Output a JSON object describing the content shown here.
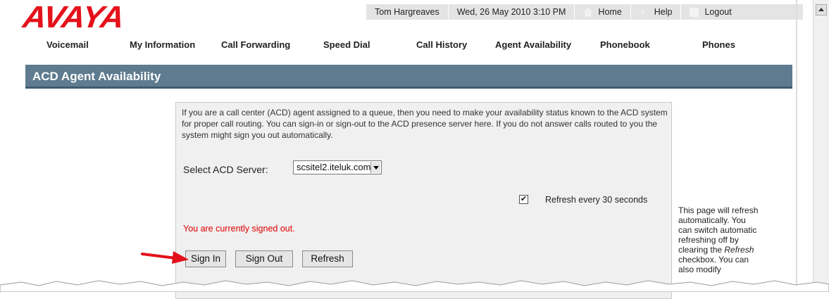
{
  "header": {
    "logo": "AVAYA",
    "user": "Tom Hargreaves",
    "datetime": "Wed, 26 May 2010 3:10 PM",
    "home": "Home",
    "help": "Help",
    "logout": "Logout"
  },
  "nav": [
    {
      "label": "Voicemail"
    },
    {
      "label": "My Information"
    },
    {
      "label": "Call Forwarding"
    },
    {
      "label": "Speed Dial"
    },
    {
      "label": "Call History"
    },
    {
      "label": "Agent Availability"
    },
    {
      "label": "Phonebook"
    },
    {
      "label": "Phones"
    }
  ],
  "page_title": "ACD Agent Availability",
  "panel": {
    "intro": "If you are a call center (ACD) agent assigned to a queue, then you need to make your availability status known to the ACD system for proper call routing. You can sign-in or sign-out to the ACD presence server here. If you do not answer calls routed to you the system might sign you out automatically.",
    "select_label": "Select ACD Server:",
    "server_value": "scsitel2.iteluk.com",
    "refresh_checked": true,
    "refresh_prefix": "Refresh every",
    "refresh_interval": "30",
    "refresh_suffix": "seconds",
    "status": "You are currently signed out.",
    "buttons": {
      "sign_in": "Sign In",
      "sign_out": "Sign Out",
      "refresh": "Refresh"
    }
  },
  "side_note": {
    "line1": "This page will refresh automatically. You can switch automatic refreshing off by clearing the",
    "italic": "Refresh",
    "line2": "checkbox. You can also modify"
  },
  "colors": {
    "brand_red": "#e4111b",
    "title_bar": "#5e7b8f",
    "status_red": "#e00000",
    "annotation_arrow": "#e4111b"
  }
}
